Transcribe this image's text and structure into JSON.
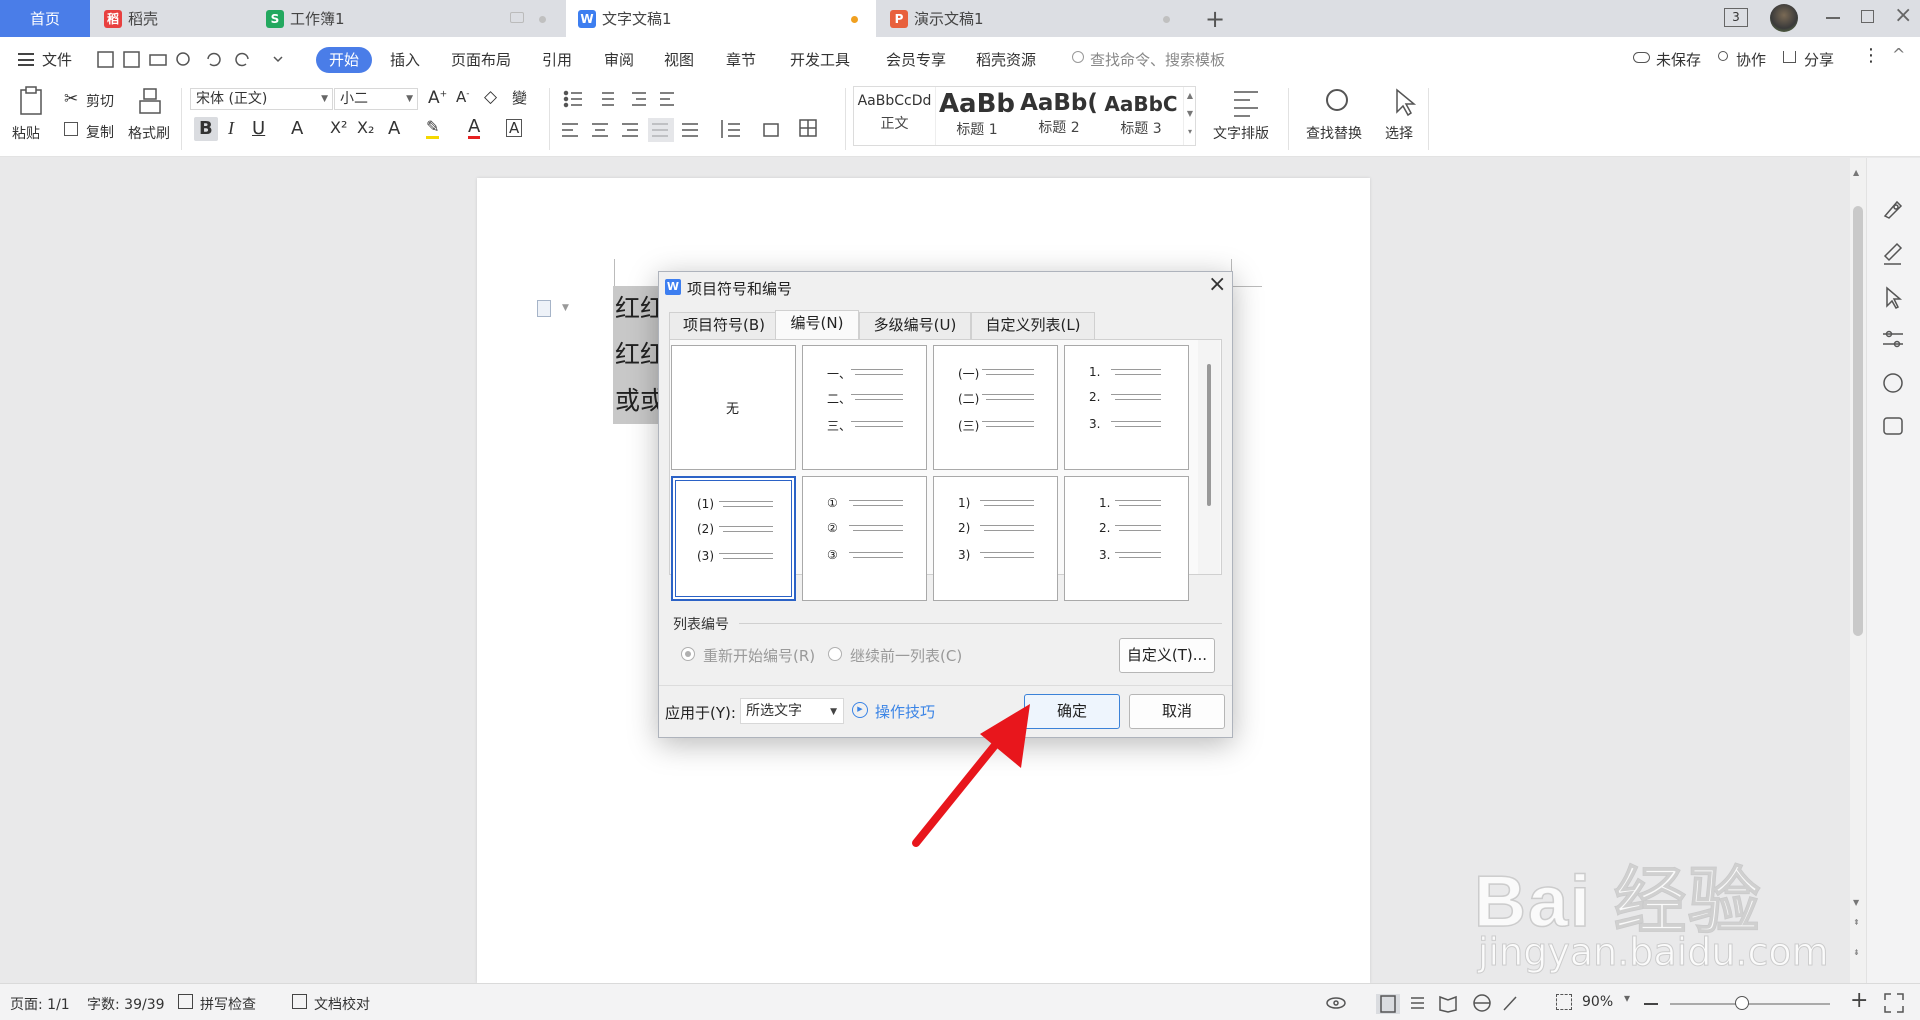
{
  "tabs": {
    "home": "首页",
    "daoke": "稻壳",
    "workbook": "工作簿1",
    "document": "文字文稿1",
    "presentation": "演示文稿1",
    "window_count": "3"
  },
  "menu": {
    "file": "文件",
    "items": [
      "开始",
      "插入",
      "页面布局",
      "引用",
      "审阅",
      "视图",
      "章节",
      "开发工具",
      "会员专享",
      "稻壳资源"
    ],
    "search_placeholder": "查找命令、搜索模板",
    "unsaved": "未保存",
    "collab": "协作",
    "share": "分享"
  },
  "ribbon": {
    "paste": "粘贴",
    "cut": "剪切",
    "copy": "复制",
    "format_painter": "格式刷",
    "font": "宋体 (正文)",
    "size": "小二",
    "styles": [
      {
        "preview": "AaBbCcDd",
        "name": "正文"
      },
      {
        "preview": "AaBb",
        "name": "标题 1"
      },
      {
        "preview": "AaBb(",
        "name": "标题 2"
      },
      {
        "preview": "AaBbC",
        "name": "标题 3"
      }
    ],
    "text_layout": "文字排版",
    "find_replace": "查找替换",
    "select": "选择"
  },
  "document": {
    "lines": [
      "红红",
      "红红",
      "或或"
    ]
  },
  "dialog": {
    "title": "项目符号和编号",
    "tabs": [
      "项目符号(B)",
      "编号(N)",
      "多级编号(U)",
      "自定义列表(L)"
    ],
    "active_tab": "编号(N)",
    "cells": [
      {
        "labels": [
          "无"
        ]
      },
      {
        "labels": [
          "一、",
          "二、",
          "三、"
        ]
      },
      {
        "labels": [
          "(一)",
          "(二)",
          "(三)"
        ]
      },
      {
        "labels": [
          "1.",
          "2.",
          "3."
        ]
      },
      {
        "labels": [
          "(1)",
          "(2)",
          "(3)"
        ],
        "selected": true
      },
      {
        "labels": [
          "①",
          "②",
          "③"
        ]
      },
      {
        "labels": [
          "1)",
          "2)",
          "3)"
        ]
      },
      {
        "labels": [
          "1.",
          "2.",
          "3."
        ]
      }
    ],
    "list_numbering_label": "列表编号",
    "restart": "重新开始编号(R)",
    "continue": "继续前一列表(C)",
    "customize": "自定义(T)...",
    "apply_to_label": "应用于(Y):",
    "apply_to_value": "所选文字",
    "tips": "操作技巧",
    "ok": "确定",
    "cancel": "取消"
  },
  "status": {
    "page": "页面: 1/1",
    "words": "字数: 39/39",
    "spellcheck": "拼写检查",
    "proofread": "文档校对",
    "zoom": "90%"
  },
  "watermark": {
    "text": "Bai 经验",
    "sub": "jingyan.baidu.com"
  },
  "colors": {
    "accent": "#4a7de8",
    "arrow": "#e8161c",
    "selection": "#2b62c6"
  }
}
